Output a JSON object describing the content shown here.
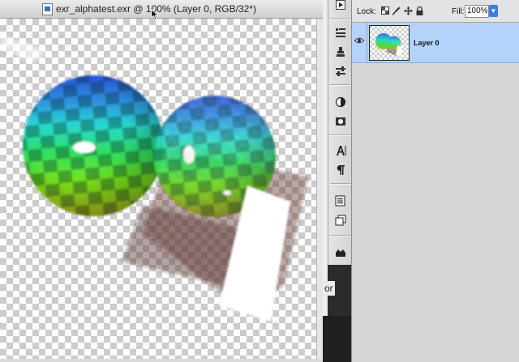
{
  "document": {
    "title": "exr_alphatest.exr @ 100% (Layer 0, RGB/32*)"
  },
  "tools_panel": {
    "buttons": [
      "play-icon",
      "brush-presets-icon",
      "clone-source-icon",
      "tool-presets-icon",
      "adjustments-icon",
      "masks-icon",
      "character-icon",
      "paragraph-icon",
      "notes-icon",
      "layer-comps-icon",
      "3d-icon"
    ],
    "partial_label": "or"
  },
  "layers_panel": {
    "lock_label": "Lock:",
    "fill_label": "Fill:",
    "fill_value": "100%",
    "layers": [
      {
        "name": "Layer 0",
        "visible": true,
        "selected": true
      }
    ]
  },
  "colors": {
    "selection": "#b3d3fb",
    "panel_bg": "#d6d6d6",
    "accent": "#3a7ee0"
  }
}
